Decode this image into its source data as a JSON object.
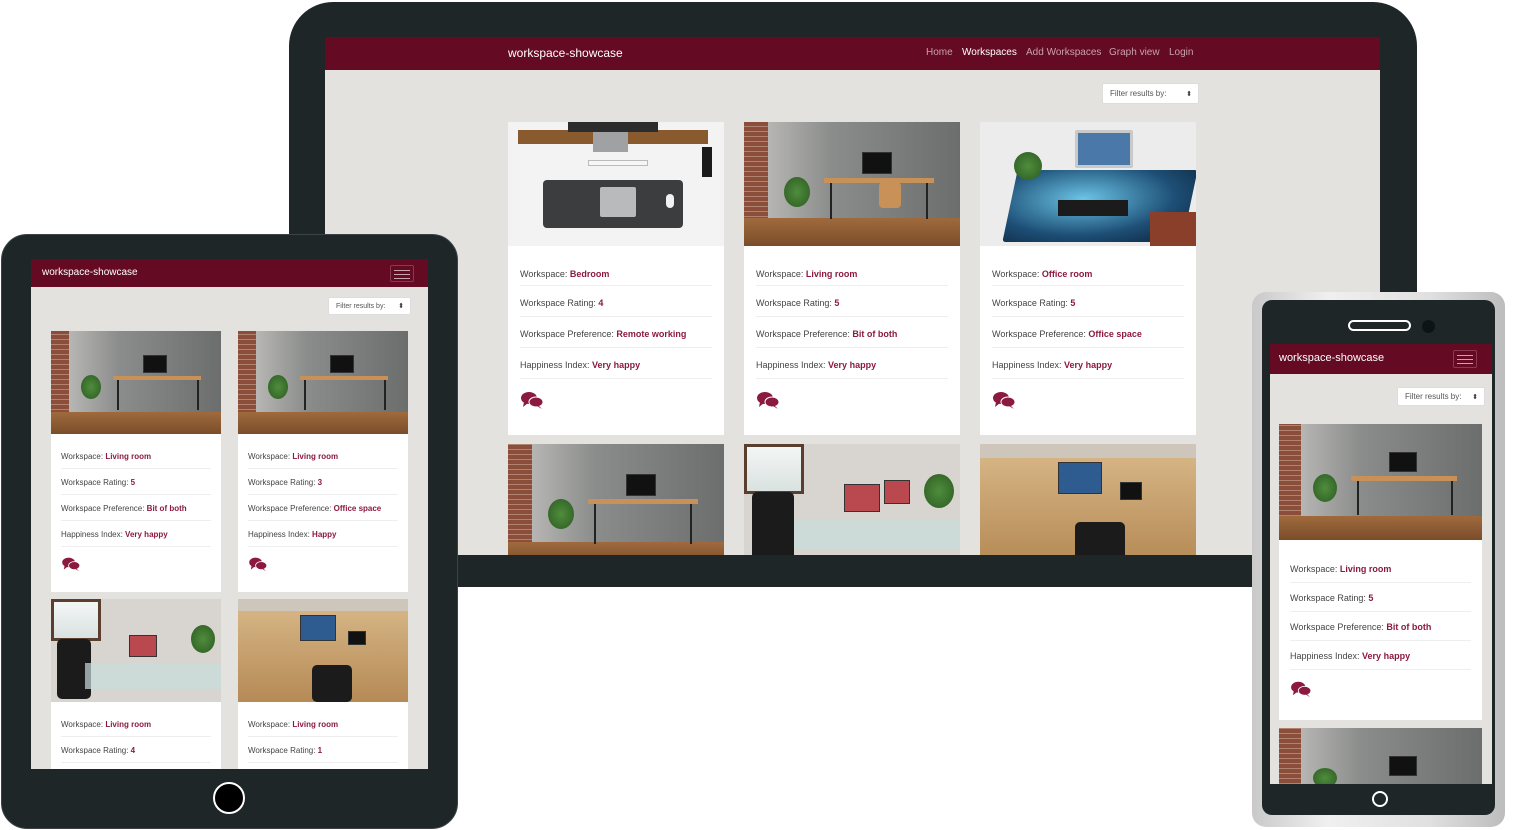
{
  "brand": "workspace-showcase",
  "nav": [
    "Home",
    "Workspaces",
    "Add Workspaces",
    "Graph view",
    "Login"
  ],
  "filter_label": "Filter results by:",
  "labels": {
    "workspace": "Workspace: ",
    "rating": "Workspace Rating: ",
    "preference": "Workspace Preference: ",
    "happiness": "Happiness Index: "
  },
  "desktop_cards": [
    {
      "workspace": "Bedroom",
      "rating": "4",
      "preference": "Remote working",
      "happiness": "Very happy"
    },
    {
      "workspace": "Living room",
      "rating": "5",
      "preference": "Bit of both",
      "happiness": "Very happy"
    },
    {
      "workspace": "Office room",
      "rating": "5",
      "preference": "Office space",
      "happiness": "Very happy"
    }
  ],
  "tablet_cards": [
    {
      "workspace": "Living room",
      "rating": "5",
      "preference": "Bit of both",
      "happiness": "Very happy"
    },
    {
      "workspace": "Living room",
      "rating": "3",
      "preference": "Office space",
      "happiness": "Happy"
    },
    {
      "workspace": "Living room",
      "rating": "4"
    },
    {
      "workspace": "Living room",
      "rating": "1"
    }
  ],
  "phone_card": {
    "workspace": "Living room",
    "rating": "5",
    "preference": "Bit of both",
    "happiness": "Very happy"
  },
  "colors": {
    "navbar": "#640a23",
    "accent": "#8b1a3f",
    "page_bg": "#e4e2df",
    "device": "#1e2628"
  },
  "icons": {
    "comments": "comments-icon",
    "menu": "hamburger-menu-icon",
    "filter_caret": "sort-caret-icon"
  }
}
